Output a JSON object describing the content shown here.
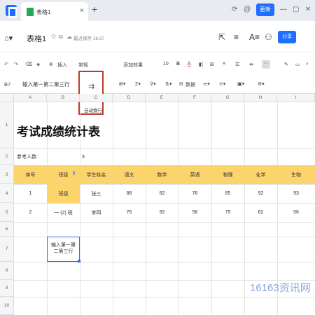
{
  "tabbar": {
    "tab_title": "表格1",
    "close_glyph": "×",
    "new_tab_glyph": "+",
    "update_label": "更新",
    "icons": [
      "sync-icon",
      "at-icon",
      "minimize-icon",
      "maximize-icon",
      "close-window-icon"
    ]
  },
  "titlebar": {
    "doc_title": "表格1",
    "save_status": "最近保存 16:37",
    "share_label": "分享"
  },
  "toolbar": {
    "insert_label": "插入",
    "font_name": "常规",
    "number_format": "添加效果",
    "font_size": "10",
    "bold": "B",
    "font_color_letter": "A"
  },
  "formula": {
    "cell_ref": "B7",
    "value": "输入第一第二第三行",
    "data_label": "数据",
    "wrap_tooltip": "自动换行"
  },
  "grid": {
    "columns": [
      "A",
      "B",
      "C",
      "D",
      "E",
      "F",
      "G",
      "H",
      "I"
    ],
    "rows": [
      "1",
      "2",
      "3",
      "4",
      "5",
      "6",
      "7",
      "8",
      "9",
      "10"
    ],
    "title": "考试成绩统计表",
    "participants_label": "参考人数:",
    "participants_value": "5",
    "headers": [
      "序号",
      "班级",
      "学生姓名",
      "语文",
      "数学",
      "英语",
      "物理",
      "化学",
      "生物"
    ],
    "row1": [
      "1",
      "班级",
      "张三",
      "88",
      "82",
      "76",
      "85",
      "92",
      "93"
    ],
    "row2": [
      "2",
      "一 (2) 班",
      "李四",
      "76",
      "92",
      "56",
      "75",
      "62",
      "56"
    ],
    "b7_text": "输入第一第二第三行"
  },
  "watermark": "16163资讯网",
  "colors": {
    "accent": "#1e6fff",
    "header_fill": "#fcd46c",
    "highlight": "#c0392b"
  }
}
